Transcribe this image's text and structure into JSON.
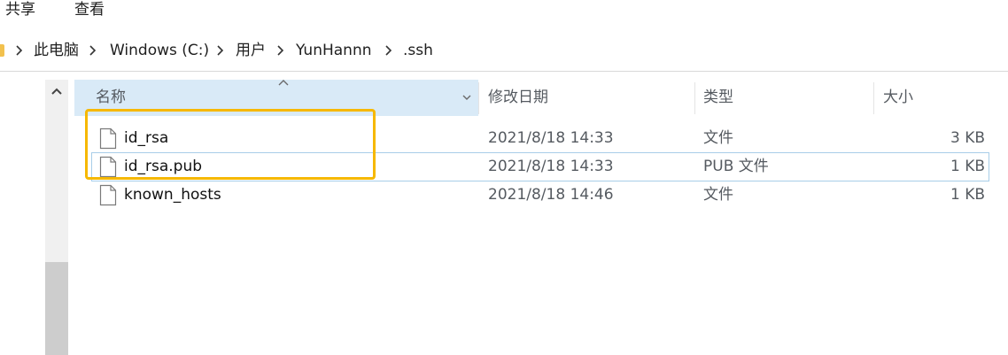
{
  "ribbon": {
    "tabs": [
      {
        "label": "共享"
      },
      {
        "label": "查看"
      }
    ]
  },
  "breadcrumb": {
    "items": [
      {
        "label": "此电脑"
      },
      {
        "label": "Windows (C:)"
      },
      {
        "label": "用户"
      },
      {
        "label": "YunHannn"
      },
      {
        "label": ".ssh"
      }
    ]
  },
  "columns": {
    "name": "名称",
    "date": "修改日期",
    "type": "类型",
    "size": "大小"
  },
  "files": [
    {
      "name": "id_rsa",
      "date": "2021/8/18 14:33",
      "type": "文件",
      "size": "3 KB",
      "icon": "file-icon"
    },
    {
      "name": "id_rsa.pub",
      "date": "2021/8/18 14:33",
      "type": "PUB 文件",
      "size": "1 KB",
      "icon": "file-icon"
    },
    {
      "name": "known_hosts",
      "date": "2021/8/18 14:46",
      "type": "文件",
      "size": "1 KB",
      "icon": "file-icon"
    }
  ],
  "colors": {
    "header_selected": "#d9eaf7",
    "highlight": "#f6b800",
    "row_selected_border": "#a8cde8"
  }
}
